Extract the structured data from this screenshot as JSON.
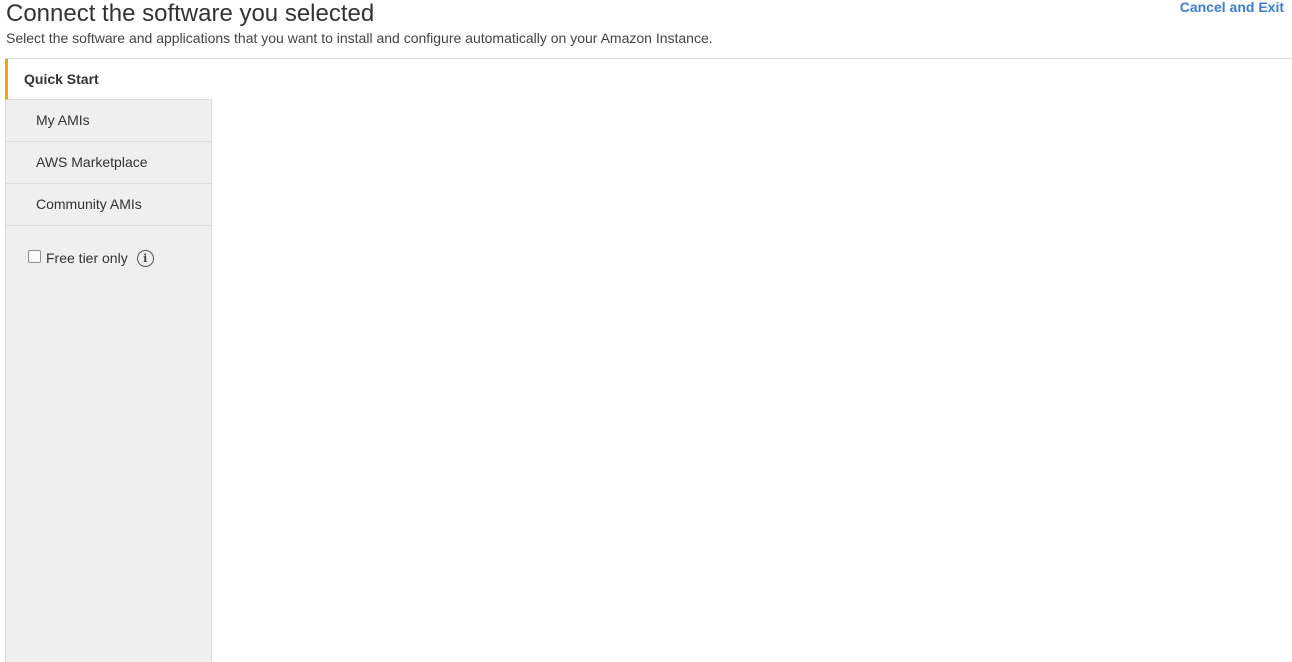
{
  "header": {
    "title": "Connect the software you selected",
    "subtitle": "Select the software and applications that you want to install and configure automatically on your Amazon Instance.",
    "cancel_label": "Cancel and Exit"
  },
  "sidebar": {
    "items": [
      {
        "label": "Quick Start",
        "active": true
      },
      {
        "label": "My AMIs",
        "active": false
      },
      {
        "label": "AWS Marketplace",
        "active": false
      },
      {
        "label": "Community AMIs",
        "active": false
      }
    ],
    "filter": {
      "label": "Free tier only",
      "checked": false,
      "info_icon": "info-icon"
    }
  },
  "colors": {
    "accent": "#f0a30a",
    "link": "#3a7fd5",
    "sidebar_bg": "#efefef"
  }
}
